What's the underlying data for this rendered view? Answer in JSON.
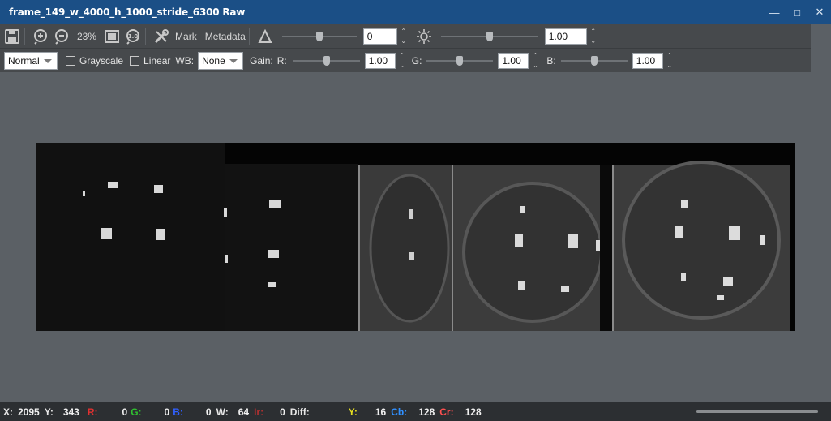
{
  "window": {
    "title": "frame_149_w_4000_h_1000_stride_6300 Raw",
    "minimize": "—",
    "maximize": "□",
    "close": "✕"
  },
  "toolbar1": {
    "zoom": "23%",
    "mark_label": "Mark",
    "metadata_label": "Metadata",
    "contrast_value": "0",
    "contrast_slider_level": 0.5,
    "brightness_value": "1.00",
    "brightness_slider_level": 0.5,
    "icons": [
      "save-icon",
      "zoom-in-icon",
      "zoom-out-icon",
      "fit-screen-icon",
      "zoom-1to1-icon",
      "tools-icon",
      "contrast-icon",
      "brightness-icon"
    ]
  },
  "toolbar2": {
    "mode": "Normal",
    "grayscale_label": "Grayscale",
    "linear_label": "Linear",
    "wb_label": "WB:",
    "wb_value": "None",
    "gain_label": "Gain:",
    "r_label": "R:",
    "r_value": "1.00",
    "g_label": "G:",
    "g_value": "1.00",
    "b_label": "B:",
    "b_value": "1.00",
    "gain_slider_level": 0.5
  },
  "status": {
    "x_label": "X:",
    "x_value": "2095",
    "y_label": "Y:",
    "y_value": "343",
    "r_label": "R:",
    "r_value": "0",
    "g_label": "G:",
    "g_value": "0",
    "b_label": "B:",
    "b_value": "0",
    "w_label": "W:",
    "w_value": "64",
    "ir_label": "Ir:",
    "ir_value": "0",
    "diff_label": "Diff:",
    "yy_label": "Y:",
    "yy_value": "16",
    "cb_label": "Cb:",
    "cb_value": "128",
    "cr_label": "Cr:",
    "cr_value": "128"
  },
  "colors": {
    "title_bar": "#1b4f86",
    "toolbar": "#46494c",
    "canvas": "#5b6065",
    "status_r": "#e03030",
    "status_g": "#30c030",
    "status_b": "#3060ff",
    "status_y": "#e8e020",
    "status_cb": "#3090ff",
    "status_cr": "#ff5050"
  }
}
